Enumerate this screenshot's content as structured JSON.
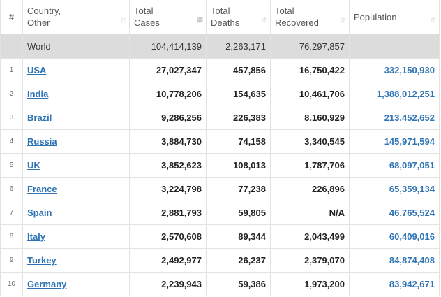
{
  "headers": {
    "num": "#",
    "country": [
      "Country,",
      "Other"
    ],
    "total_cases": [
      "Total",
      "Cases"
    ],
    "total_deaths": [
      "Total",
      "Deaths"
    ],
    "total_recovered": [
      "Total",
      "Recovered"
    ],
    "population": "Population"
  },
  "world": {
    "label": "World",
    "total_cases": "104,414,139",
    "total_deaths": "2,263,171",
    "total_recovered": "76,297,857",
    "population": ""
  },
  "rows": [
    {
      "idx": "1",
      "country": "USA",
      "total_cases": "27,027,347",
      "total_deaths": "457,856",
      "total_recovered": "16,750,422",
      "population": "332,150,930"
    },
    {
      "idx": "2",
      "country": "India",
      "total_cases": "10,778,206",
      "total_deaths": "154,635",
      "total_recovered": "10,461,706",
      "population": "1,388,012,251"
    },
    {
      "idx": "3",
      "country": "Brazil",
      "total_cases": "9,286,256",
      "total_deaths": "226,383",
      "total_recovered": "8,160,929",
      "population": "213,452,652"
    },
    {
      "idx": "4",
      "country": "Russia",
      "total_cases": "3,884,730",
      "total_deaths": "74,158",
      "total_recovered": "3,340,545",
      "population": "145,971,594"
    },
    {
      "idx": "5",
      "country": "UK",
      "total_cases": "3,852,623",
      "total_deaths": "108,013",
      "total_recovered": "1,787,706",
      "population": "68,097,051"
    },
    {
      "idx": "6",
      "country": "France",
      "total_cases": "3,224,798",
      "total_deaths": "77,238",
      "total_recovered": "226,896",
      "population": "65,359,134"
    },
    {
      "idx": "7",
      "country": "Spain",
      "total_cases": "2,881,793",
      "total_deaths": "59,805",
      "total_recovered": "N/A",
      "population": "46,765,524"
    },
    {
      "idx": "8",
      "country": "Italy",
      "total_cases": "2,570,608",
      "total_deaths": "89,344",
      "total_recovered": "2,043,499",
      "population": "60,409,016"
    },
    {
      "idx": "9",
      "country": "Turkey",
      "total_cases": "2,492,977",
      "total_deaths": "26,237",
      "total_recovered": "2,379,070",
      "population": "84,874,408"
    },
    {
      "idx": "10",
      "country": "Germany",
      "total_cases": "2,239,943",
      "total_deaths": "59,386",
      "total_recovered": "1,973,200",
      "population": "83,942,671"
    }
  ],
  "icons": {
    "sort_inactive": "sort-icon",
    "sort_active": "sort-descending-icon"
  },
  "colors": {
    "link": "#2e74b5",
    "world_row_bg": "#dcdcdc",
    "border": "#e2e2e2"
  }
}
